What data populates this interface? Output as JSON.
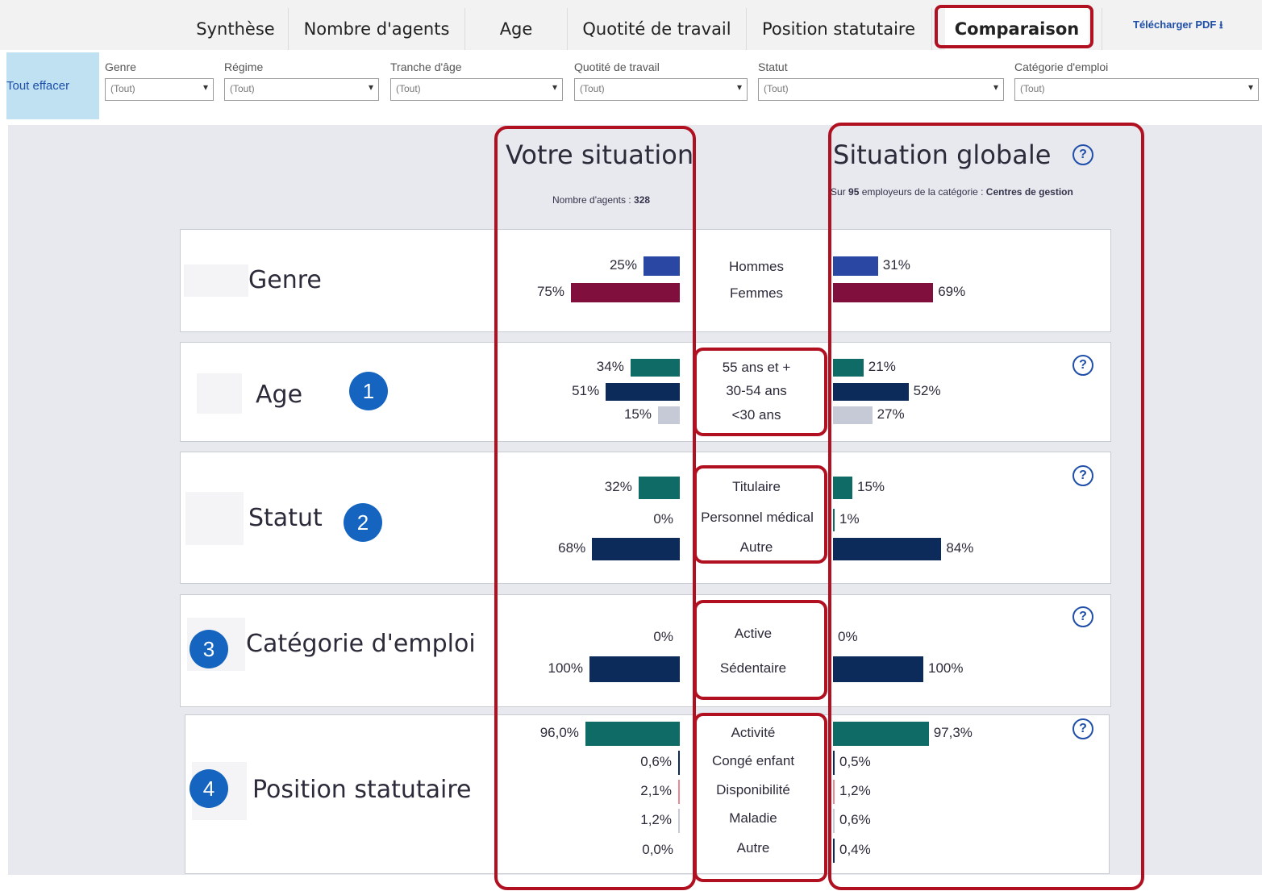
{
  "tabs": [
    "Synthèse",
    "Nombre d'agents",
    "Age",
    "Quotité de travail",
    "Position statutaire",
    "Comparaison"
  ],
  "download_label": "Télécharger PDF",
  "filters": {
    "clear_label": "Tout effacer",
    "items": [
      {
        "label": "Genre",
        "value": "(Tout)"
      },
      {
        "label": "Régime",
        "value": "(Tout)"
      },
      {
        "label": "Tranche d'âge",
        "value": "(Tout)"
      },
      {
        "label": "Quotité de travail",
        "value": "(Tout)"
      },
      {
        "label": "Statut",
        "value": "(Tout)"
      },
      {
        "label": "Catégorie d'emploi",
        "value": "(Tout)"
      }
    ]
  },
  "columns": {
    "left_title": "Votre situation",
    "left_sub_prefix": "Nombre d'agents : ",
    "left_sub_value": "328",
    "right_title": "Situation globale",
    "right_sub_prefix": "Sur ",
    "right_sub_count": "95",
    "right_sub_mid": " employeurs de la catégorie : ",
    "right_sub_value": "Centres de gestion"
  },
  "colors": {
    "blue": "#2a47a3",
    "crimson": "#800f3e",
    "teal": "#0f6b66",
    "navy": "#0d2b5a",
    "gray": "#c6c9d6",
    "pink": "#e88a94"
  },
  "sections": [
    {
      "title": "Genre",
      "badge": "",
      "rows": [
        {
          "label": "Hommes",
          "left": {
            "text": "25%",
            "value": 25
          },
          "right": {
            "text": "31%",
            "value": 31
          },
          "color": "blue"
        },
        {
          "label": "Femmes",
          "left": {
            "text": "75%",
            "value": 75
          },
          "right": {
            "text": "69%",
            "value": 69
          },
          "color": "crimson"
        }
      ]
    },
    {
      "title": "Age",
      "badge": "1",
      "rows": [
        {
          "label": "55 ans et +",
          "left": {
            "text": "34%",
            "value": 34
          },
          "right": {
            "text": "21%",
            "value": 21
          },
          "color": "teal"
        },
        {
          "label": "30-54 ans",
          "left": {
            "text": "51%",
            "value": 51
          },
          "right": {
            "text": "52%",
            "value": 52
          },
          "color": "navy"
        },
        {
          "label": "<30 ans",
          "left": {
            "text": "15%",
            "value": 15
          },
          "right": {
            "text": "27%",
            "value": 27
          },
          "color": "gray"
        }
      ]
    },
    {
      "title": "Statut",
      "badge": "2",
      "rows": [
        {
          "label": "Titulaire",
          "left": {
            "text": "32%",
            "value": 32
          },
          "right": {
            "text": "15%",
            "value": 15
          },
          "color": "teal"
        },
        {
          "label": "Personnel médical",
          "left": {
            "text": "0%",
            "value": 0
          },
          "right": {
            "text": "1%",
            "value": 1
          },
          "color": "teal"
        },
        {
          "label": "Autre",
          "left": {
            "text": "68%",
            "value": 68
          },
          "right": {
            "text": "84%",
            "value": 84
          },
          "color": "navy"
        }
      ]
    },
    {
      "title": "Catégorie d'emploi",
      "badge": "3",
      "rows": [
        {
          "label": "Active",
          "left": {
            "text": "0%",
            "value": 0
          },
          "right": {
            "text": "0%",
            "value": 0
          },
          "color": "teal"
        },
        {
          "label": "Sédentaire",
          "left": {
            "text": "100%",
            "value": 100
          },
          "right": {
            "text": "100%",
            "value": 100
          },
          "color": "navy"
        }
      ]
    },
    {
      "title": "Position statutaire",
      "badge": "4",
      "rows": [
        {
          "label": "Activité",
          "left": {
            "text": "96,0%",
            "value": 96.0
          },
          "right": {
            "text": "97,3%",
            "value": 97.3
          },
          "color": "teal"
        },
        {
          "label": "Congé enfant",
          "left": {
            "text": "0,6%",
            "value": 0.6
          },
          "right": {
            "text": "0,5%",
            "value": 0.5
          },
          "color": "navy"
        },
        {
          "label": "Disponibilité",
          "left": {
            "text": "2,1%",
            "value": 2.1
          },
          "right": {
            "text": "1,2%",
            "value": 1.2
          },
          "color": "pink"
        },
        {
          "label": "Maladie",
          "left": {
            "text": "1,2%",
            "value": 1.2
          },
          "right": {
            "text": "0,6%",
            "value": 0.6
          },
          "color": "gray"
        },
        {
          "label": "Autre",
          "left": {
            "text": "0,0%",
            "value": 0.0
          },
          "right": {
            "text": "0,4%",
            "value": 0.4
          },
          "color": "navy"
        }
      ]
    }
  ]
}
